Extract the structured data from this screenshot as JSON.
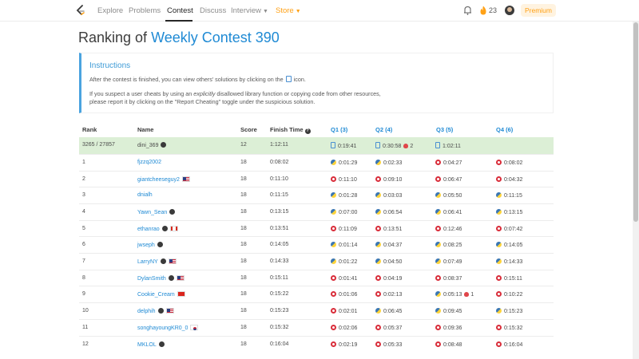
{
  "nav": {
    "items": [
      "Explore",
      "Problems",
      "Contest",
      "Discuss",
      "Interview",
      "Store"
    ],
    "active": "Contest",
    "streak": "23",
    "premium": "Premium"
  },
  "title": {
    "prefix": "Ranking of ",
    "contest": "Weekly Contest 390"
  },
  "instructions": {
    "title": "Instructions",
    "line1a": "After the contest is finished, you can view others' solutions by clicking on the",
    "line1b": "icon.",
    "line2a": "If you suspect a user cheats by using an ",
    "line2em": "explicitly",
    "line2b": " disallowed library function or copying code from other resources,",
    "line3": "please report it by clicking on the \"Report Cheating\" toggle under the suspicious solution."
  },
  "table": {
    "headers": {
      "rank": "Rank",
      "name": "Name",
      "score": "Score",
      "finish": "Finish Time",
      "q1": "Q1 (3)",
      "q2": "Q2 (4)",
      "q3": "Q3 (5)",
      "q4": "Q4 (6)"
    },
    "rows": [
      {
        "rank": "3265 / 27857",
        "name": "dini_369",
        "badge": true,
        "flag": "",
        "score": "12",
        "finish": "1:12:11",
        "q1": {
          "t": "0:19:41",
          "l": "doc"
        },
        "q2": {
          "t": "0:30:58",
          "l": "doc",
          "pen": "2"
        },
        "q3": {
          "t": "1:02:11",
          "l": "doc"
        },
        "q4": {
          "t": "",
          "l": ""
        }
      },
      {
        "rank": "1",
        "name": "fjzzq2002",
        "badge": false,
        "flag": "",
        "score": "18",
        "finish": "0:08:02",
        "q1": {
          "t": "0:01:29",
          "l": "py"
        },
        "q2": {
          "t": "0:02:33",
          "l": "py"
        },
        "q3": {
          "t": "0:04:27",
          "l": "cpp"
        },
        "q4": {
          "t": "0:08:02",
          "l": "cpp"
        }
      },
      {
        "rank": "2",
        "name": "giantcheeseguy2",
        "badge": false,
        "flag": "us",
        "score": "18",
        "finish": "0:11:10",
        "q1": {
          "t": "0:11:10",
          "l": "cpp"
        },
        "q2": {
          "t": "0:09:10",
          "l": "cpp"
        },
        "q3": {
          "t": "0:06:47",
          "l": "cpp"
        },
        "q4": {
          "t": "0:04:32",
          "l": "cpp"
        }
      },
      {
        "rank": "3",
        "name": "dnialh",
        "badge": false,
        "flag": "",
        "score": "18",
        "finish": "0:11:15",
        "q1": {
          "t": "0:01:28",
          "l": "py"
        },
        "q2": {
          "t": "0:03:03",
          "l": "py"
        },
        "q3": {
          "t": "0:05:50",
          "l": "py"
        },
        "q4": {
          "t": "0:11:15",
          "l": "py"
        }
      },
      {
        "rank": "4",
        "name": "Yawn_Sean",
        "badge": true,
        "flag": "",
        "score": "18",
        "finish": "0:13:15",
        "q1": {
          "t": "0:07:00",
          "l": "py"
        },
        "q2": {
          "t": "0:06:54",
          "l": "py"
        },
        "q3": {
          "t": "0:06:41",
          "l": "py"
        },
        "q4": {
          "t": "0:13:15",
          "l": "py"
        }
      },
      {
        "rank": "5",
        "name": "ethanrao",
        "badge": true,
        "flag": "ca",
        "score": "18",
        "finish": "0:13:51",
        "q1": {
          "t": "0:11:09",
          "l": "cpp"
        },
        "q2": {
          "t": "0:13:51",
          "l": "cpp"
        },
        "q3": {
          "t": "0:12:46",
          "l": "cpp"
        },
        "q4": {
          "t": "0:07:42",
          "l": "cpp"
        }
      },
      {
        "rank": "6",
        "name": "jwseph",
        "badge": true,
        "flag": "",
        "score": "18",
        "finish": "0:14:05",
        "q1": {
          "t": "0:01:14",
          "l": "py"
        },
        "q2": {
          "t": "0:04:37",
          "l": "py"
        },
        "q3": {
          "t": "0:08:25",
          "l": "py"
        },
        "q4": {
          "t": "0:14:05",
          "l": "py"
        }
      },
      {
        "rank": "7",
        "name": "LarryNY",
        "badge": true,
        "flag": "us",
        "score": "18",
        "finish": "0:14:33",
        "q1": {
          "t": "0:01:22",
          "l": "py"
        },
        "q2": {
          "t": "0:04:50",
          "l": "py"
        },
        "q3": {
          "t": "0:07:49",
          "l": "py"
        },
        "q4": {
          "t": "0:14:33",
          "l": "py"
        }
      },
      {
        "rank": "8",
        "name": "DylanSmith",
        "badge": true,
        "flag": "us",
        "score": "18",
        "finish": "0:15:11",
        "q1": {
          "t": "0:01:41",
          "l": "cpp"
        },
        "q2": {
          "t": "0:04:19",
          "l": "cpp"
        },
        "q3": {
          "t": "0:08:37",
          "l": "cpp"
        },
        "q4": {
          "t": "0:15:11",
          "l": "cpp"
        }
      },
      {
        "rank": "9",
        "name": "Cookie_Cream",
        "badge": false,
        "flag": "vn",
        "score": "18",
        "finish": "0:15:22",
        "q1": {
          "t": "0:01:06",
          "l": "cpp"
        },
        "q2": {
          "t": "0:02:13",
          "l": "cpp"
        },
        "q3": {
          "t": "0:05:13",
          "l": "py",
          "pen": "1"
        },
        "q4": {
          "t": "0:10:22",
          "l": "cpp"
        }
      },
      {
        "rank": "10",
        "name": "delphih",
        "badge": true,
        "flag": "us",
        "score": "18",
        "finish": "0:15:23",
        "q1": {
          "t": "0:02:01",
          "l": "cpp"
        },
        "q2": {
          "t": "0:06:45",
          "l": "py"
        },
        "q3": {
          "t": "0:09:45",
          "l": "py"
        },
        "q4": {
          "t": "0:15:23",
          "l": "py"
        }
      },
      {
        "rank": "11",
        "name": "songhayoungKR0_0",
        "badge": false,
        "flag": "kr",
        "score": "18",
        "finish": "0:15:32",
        "q1": {
          "t": "0:02:06",
          "l": "cpp"
        },
        "q2": {
          "t": "0:05:37",
          "l": "cpp"
        },
        "q3": {
          "t": "0:09:36",
          "l": "cpp"
        },
        "q4": {
          "t": "0:15:32",
          "l": "cpp"
        }
      },
      {
        "rank": "12",
        "name": "MKLOL",
        "badge": true,
        "flag": "",
        "score": "18",
        "finish": "0:16:04",
        "q1": {
          "t": "0:02:19",
          "l": "cpp"
        },
        "q2": {
          "t": "0:05:33",
          "l": "cpp"
        },
        "q3": {
          "t": "0:08:48",
          "l": "cpp"
        },
        "q4": {
          "t": "0:16:04",
          "l": "cpp"
        }
      }
    ]
  },
  "colors": {
    "accent": "#1f8ad4",
    "brand": "#ffa116",
    "highlight_row": "#dcefd6"
  },
  "icons": [
    "leetcode-logo",
    "bell-icon",
    "fire-icon",
    "document-icon",
    "cpp-icon",
    "python-icon",
    "bug-icon",
    "help-icon"
  ]
}
